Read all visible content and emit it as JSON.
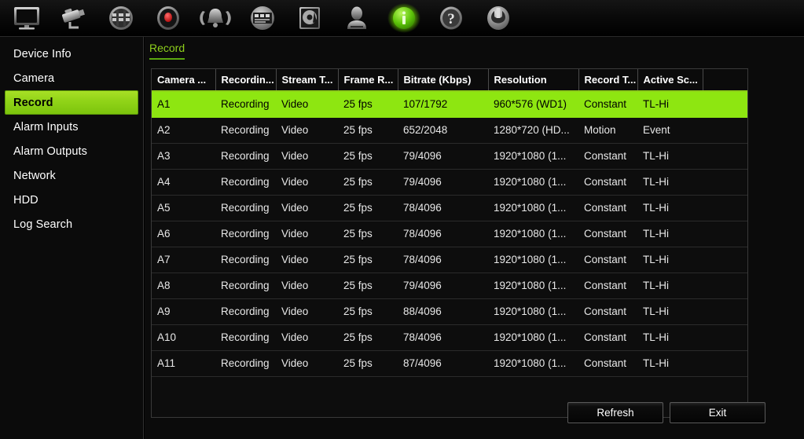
{
  "toolbar": {
    "items": [
      {
        "icon": "monitor-icon",
        "label": "Live View"
      },
      {
        "icon": "camera-icon",
        "label": "Camera"
      },
      {
        "icon": "playback-icon",
        "label": "Playback"
      },
      {
        "icon": "record-icon",
        "label": "Record"
      },
      {
        "icon": "alarm-icon",
        "label": "Alarm"
      },
      {
        "icon": "network-icon",
        "label": "Network"
      },
      {
        "icon": "hdd-icon",
        "label": "HDD"
      },
      {
        "icon": "user-icon",
        "label": "User"
      },
      {
        "icon": "info-icon",
        "label": "Info"
      },
      {
        "icon": "help-icon",
        "label": "Help"
      },
      {
        "icon": "power-icon",
        "label": "Shutdown"
      }
    ]
  },
  "sidebar": {
    "items": [
      {
        "label": "Device Info",
        "selected": false
      },
      {
        "label": "Camera",
        "selected": false
      },
      {
        "label": "Record",
        "selected": true
      },
      {
        "label": "Alarm Inputs",
        "selected": false
      },
      {
        "label": "Alarm Outputs",
        "selected": false
      },
      {
        "label": "Network",
        "selected": false
      },
      {
        "label": "HDD",
        "selected": false
      },
      {
        "label": "Log Search",
        "selected": false
      }
    ]
  },
  "main": {
    "tab_label": "Record",
    "table": {
      "columns": [
        "Camera ...",
        "Recordin...",
        "Stream T...",
        "Frame R...",
        "Bitrate (Kbps)",
        "Resolution",
        "Record T...",
        "Active Sc...",
        ""
      ],
      "rows": [
        {
          "selected": true,
          "cells": [
            "A1",
            "Recording",
            "Video",
            "25 fps",
            "107/1792",
            "960*576 (WD1)",
            "Constant",
            "TL-Hi",
            ""
          ]
        },
        {
          "selected": false,
          "cells": [
            "A2",
            "Recording",
            "Video",
            "25 fps",
            "652/2048",
            "1280*720 (HD...",
            "Motion",
            "Event",
            ""
          ]
        },
        {
          "selected": false,
          "cells": [
            "A3",
            "Recording",
            "Video",
            "25 fps",
            "79/4096",
            "1920*1080 (1...",
            "Constant",
            "TL-Hi",
            ""
          ]
        },
        {
          "selected": false,
          "cells": [
            "A4",
            "Recording",
            "Video",
            "25 fps",
            "79/4096",
            "1920*1080 (1...",
            "Constant",
            "TL-Hi",
            ""
          ]
        },
        {
          "selected": false,
          "cells": [
            "A5",
            "Recording",
            "Video",
            "25 fps",
            "78/4096",
            "1920*1080 (1...",
            "Constant",
            "TL-Hi",
            ""
          ]
        },
        {
          "selected": false,
          "cells": [
            "A6",
            "Recording",
            "Video",
            "25 fps",
            "78/4096",
            "1920*1080 (1...",
            "Constant",
            "TL-Hi",
            ""
          ]
        },
        {
          "selected": false,
          "cells": [
            "A7",
            "Recording",
            "Video",
            "25 fps",
            "78/4096",
            "1920*1080 (1...",
            "Constant",
            "TL-Hi",
            ""
          ]
        },
        {
          "selected": false,
          "cells": [
            "A8",
            "Recording",
            "Video",
            "25 fps",
            "79/4096",
            "1920*1080 (1...",
            "Constant",
            "TL-Hi",
            ""
          ]
        },
        {
          "selected": false,
          "cells": [
            "A9",
            "Recording",
            "Video",
            "25 fps",
            "88/4096",
            "1920*1080 (1...",
            "Constant",
            "TL-Hi",
            ""
          ]
        },
        {
          "selected": false,
          "cells": [
            "A10",
            "Recording",
            "Video",
            "25 fps",
            "78/4096",
            "1920*1080 (1...",
            "Constant",
            "TL-Hi",
            ""
          ]
        },
        {
          "selected": false,
          "cells": [
            "A11",
            "Recording",
            "Video",
            "25 fps",
            "87/4096",
            "1920*1080 (1...",
            "Constant",
            "TL-Hi",
            ""
          ]
        }
      ]
    },
    "scrollbar": {
      "up_icon": "chevron-up-icon",
      "down_icon": "chevron-down-icon"
    },
    "buttons": {
      "refresh_label": "Refresh",
      "exit_label": "Exit"
    }
  },
  "colors": {
    "accent_green": "#8ee611",
    "tab_green": "#8ecf1c",
    "background": "#0b0b0b"
  }
}
